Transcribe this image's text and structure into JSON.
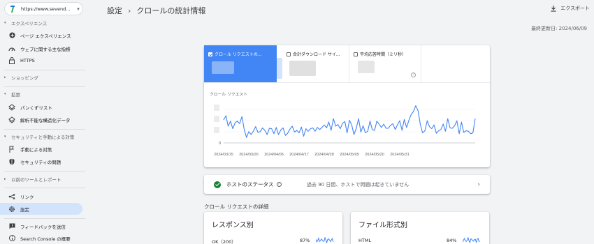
{
  "sidebar": {
    "property": "https://www.sevend...",
    "sections": [
      {
        "label": "エクスペリエンス",
        "items": [
          {
            "label": "ページ エクスペリエンス",
            "icon": "plus-circle-icon"
          },
          {
            "label": "ウェブに関する主な指標",
            "icon": "speed-icon"
          },
          {
            "label": "HTTPS",
            "icon": "lock-icon"
          }
        ]
      },
      {
        "label": "ショッピング",
        "items": []
      },
      {
        "label": "拡張",
        "items": [
          {
            "label": "パンくずリスト",
            "icon": "layers-icon"
          },
          {
            "label": "解析不能な構造化データ",
            "icon": "layers-icon"
          }
        ]
      },
      {
        "label": "セキュリティと手動による対策",
        "items": [
          {
            "label": "手動による対策",
            "icon": "flag-icon"
          },
          {
            "label": "セキュリティの問題",
            "icon": "shield-icon"
          }
        ]
      },
      {
        "label": "以前のツールとレポート",
        "items": []
      }
    ],
    "bottom_items": [
      {
        "label": "リンク",
        "icon": "links-icon"
      },
      {
        "label": "設定",
        "icon": "gear-icon",
        "active": true
      },
      {
        "label": "フィードバックを送信",
        "icon": "feedback-icon"
      },
      {
        "label": "Search Console の概要",
        "icon": "info-icon"
      }
    ]
  },
  "header": {
    "crumb_root": "設定",
    "crumb_sep": "›",
    "crumb_page": "クロールの統計情報",
    "export_label": "エクスポート",
    "last_updated": "最終更新日: 2024/06/09"
  },
  "metrics": [
    {
      "label": "クロール リクエストの...",
      "selected": true
    },
    {
      "label": "合計ダウンロード サイ...",
      "selected": false
    },
    {
      "label": "平均応答時間（ミリ秒）",
      "selected": false
    }
  ],
  "chart_data": {
    "type": "line",
    "title": "クロール リクエスト",
    "x_ticks": [
      "2024/03/15",
      "2024/03/26",
      "2024/04/06",
      "2024/04/17",
      "2024/04/28",
      "2024/05/09",
      "2024/05/20",
      "2024/05/31"
    ],
    "y_ticks": [
      "0"
    ],
    "ylim": [
      0,
      100
    ],
    "color": "#4285f4",
    "series": [
      {
        "values": [
          55,
          65,
          40,
          52,
          34,
          48,
          52,
          46,
          63,
          32,
          13,
          27,
          20,
          28,
          39,
          25,
          27,
          36,
          30,
          20,
          35,
          34,
          22,
          37,
          20,
          31,
          36,
          18,
          23,
          33,
          40,
          26,
          30,
          24,
          38,
          16,
          34,
          28,
          34,
          36,
          28,
          37,
          32,
          37,
          43,
          36,
          50,
          30,
          58,
          40,
          44,
          34,
          47,
          51,
          24,
          54,
          43,
          20,
          35,
          58,
          26,
          41,
          24,
          28,
          52,
          32,
          30,
          52,
          45,
          37,
          45,
          35,
          35,
          42,
          46,
          32,
          43,
          53,
          30,
          56,
          37,
          54,
          68,
          75,
          89,
          77,
          44,
          24,
          29,
          53,
          39,
          34,
          43,
          23,
          29,
          32,
          45,
          28,
          58,
          36,
          35,
          41,
          53,
          22,
          50,
          25,
          29,
          28,
          22,
          24,
          58
        ]
      }
    ]
  },
  "host_status": {
    "title": "ホストのステータス",
    "message": "過去 90 日間、ホストで問題は起きていません"
  },
  "details": {
    "title": "クロール リクエストの詳細",
    "cards": [
      {
        "title": "レスポンス別",
        "row_label": "OK（200）",
        "row_pct": "87%"
      },
      {
        "title": "ファイル形式別",
        "row_label": "HTML",
        "row_pct": "84%"
      }
    ]
  }
}
